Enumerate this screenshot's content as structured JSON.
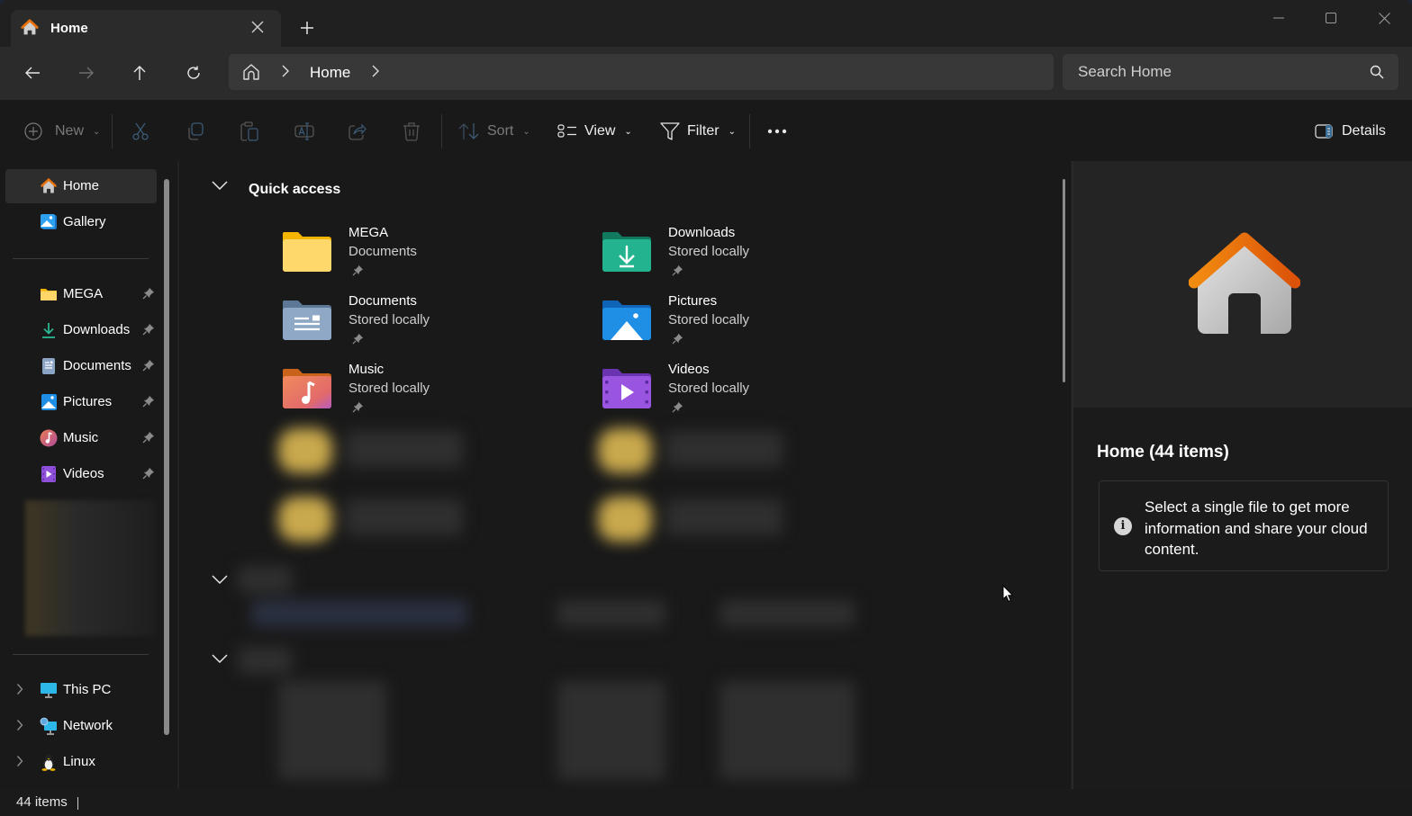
{
  "window": {
    "tab": {
      "title": "Home",
      "icon": "home-icon",
      "close_icon": "close-icon"
    },
    "new_tab_icon": "plus-icon",
    "controls": {
      "minimize": "minimize-icon",
      "maximize": "maximize-icon",
      "close": "close-icon"
    }
  },
  "nav": {
    "back": "arrow-left-icon",
    "forward": "arrow-right-icon",
    "up": "arrow-up-icon",
    "refresh": "refresh-icon",
    "breadcrumb": [
      "Home"
    ],
    "search_placeholder": "Search Home"
  },
  "toolbar": {
    "new_label": "New",
    "cut": "cut-icon",
    "copy": "copy-icon",
    "paste": "paste-icon",
    "rename": "rename-icon",
    "share": "share-icon",
    "delete": "delete-icon",
    "sort_label": "Sort",
    "view_label": "View",
    "filter_label": "Filter",
    "more": "more-icon",
    "details_label": "Details"
  },
  "sidebar": {
    "top": [
      {
        "label": "Home",
        "icon": "home-icon",
        "selected": true
      },
      {
        "label": "Gallery",
        "icon": "gallery-icon"
      }
    ],
    "pinned": [
      {
        "label": "MEGA",
        "icon": "folder-icon",
        "pinned": true
      },
      {
        "label": "Downloads",
        "icon": "download-icon",
        "pinned": true
      },
      {
        "label": "Documents",
        "icon": "document-icon",
        "pinned": true
      },
      {
        "label": "Pictures",
        "icon": "pictures-icon",
        "pinned": true
      },
      {
        "label": "Music",
        "icon": "music-icon",
        "pinned": true
      },
      {
        "label": "Videos",
        "icon": "videos-icon",
        "pinned": true
      }
    ],
    "bottom": [
      {
        "label": "This PC",
        "icon": "computer-icon"
      },
      {
        "label": "Network",
        "icon": "network-icon"
      },
      {
        "label": "Linux",
        "icon": "linux-icon"
      }
    ]
  },
  "main": {
    "quick_access_title": "Quick access",
    "tiles": [
      {
        "name": "MEGA",
        "sub": "Documents",
        "icon": "folder-icon",
        "color": "#f6c744"
      },
      {
        "name": "Downloads",
        "sub": "Stored locally",
        "icon": "downloads-folder-icon",
        "color": "#22b491"
      },
      {
        "name": "Documents",
        "sub": "Stored locally",
        "icon": "documents-folder-icon",
        "color": "#8ba4c4"
      },
      {
        "name": "Pictures",
        "sub": "Stored locally",
        "icon": "pictures-folder-icon",
        "color": "#1e88e5"
      },
      {
        "name": "Music",
        "sub": "Stored locally",
        "icon": "music-folder-icon",
        "color": "#e5795f"
      },
      {
        "name": "Videos",
        "sub": "Stored locally",
        "icon": "videos-folder-icon",
        "color": "#8e4fd9"
      }
    ]
  },
  "details": {
    "title": "Home (44 items)",
    "info": "Select a single file to get more information and share your cloud content."
  },
  "status": {
    "count": "44 items"
  }
}
